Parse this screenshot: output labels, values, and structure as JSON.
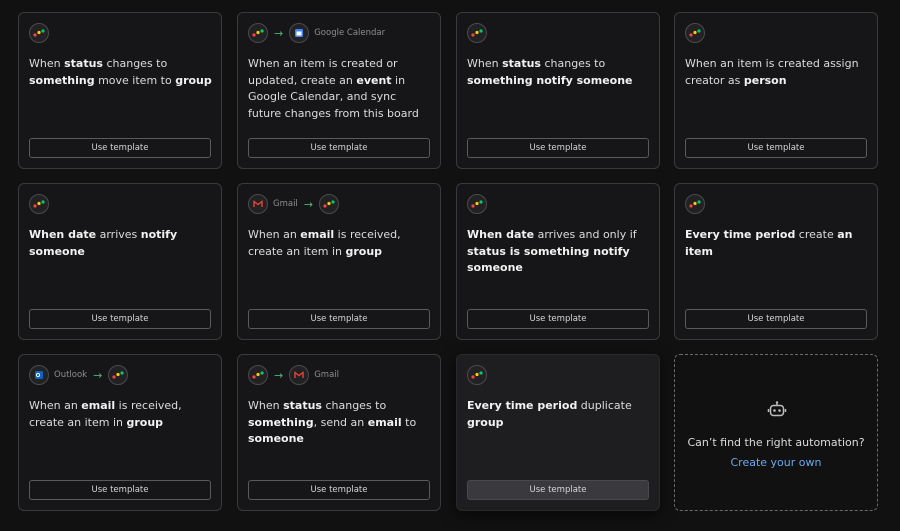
{
  "templates": [
    {
      "segments": [
        {
          "t": "When ",
          "b": false
        },
        {
          "t": "status",
          "b": true
        },
        {
          "t": " changes to ",
          "b": false
        },
        {
          "t": "something",
          "b": true
        },
        {
          "t": " move item to ",
          "b": false
        },
        {
          "t": "group",
          "b": true
        }
      ],
      "button": "Use template"
    },
    {
      "apps": {
        "from": "",
        "to": "Google Calendar"
      },
      "segments": [
        {
          "t": "When an item is created or updated, create an ",
          "b": false
        },
        {
          "t": "event",
          "b": true
        },
        {
          "t": " in Google Calendar, and sync future changes from this board",
          "b": false
        }
      ],
      "button": "Use template"
    },
    {
      "segments": [
        {
          "t": "When ",
          "b": false
        },
        {
          "t": "status",
          "b": true
        },
        {
          "t": " changes to ",
          "b": false
        },
        {
          "t": "something notify someone",
          "b": true
        }
      ],
      "button": "Use template"
    },
    {
      "segments": [
        {
          "t": "When an item is created assign creator as ",
          "b": false
        },
        {
          "t": "person",
          "b": true
        }
      ],
      "button": "Use template"
    },
    {
      "segments": [
        {
          "t": "When date",
          "b": true
        },
        {
          "t": " arrives ",
          "b": false
        },
        {
          "t": "notify someone",
          "b": true
        }
      ],
      "button": "Use template"
    },
    {
      "apps": {
        "from": "Gmail",
        "to": ""
      },
      "segments": [
        {
          "t": "When an ",
          "b": false
        },
        {
          "t": "email",
          "b": true
        },
        {
          "t": " is received, create an item in ",
          "b": false
        },
        {
          "t": "group",
          "b": true
        }
      ],
      "button": "Use template"
    },
    {
      "segments": [
        {
          "t": "When date",
          "b": true
        },
        {
          "t": " arrives and only if ",
          "b": false
        },
        {
          "t": "status is something notify someone",
          "b": true
        }
      ],
      "button": "Use template"
    },
    {
      "segments": [
        {
          "t": "Every time period",
          "b": true
        },
        {
          "t": " create ",
          "b": false
        },
        {
          "t": "an item",
          "b": true
        }
      ],
      "button": "Use template"
    },
    {
      "apps": {
        "from": "Outlook",
        "to": ""
      },
      "segments": [
        {
          "t": "When an ",
          "b": false
        },
        {
          "t": "email",
          "b": true
        },
        {
          "t": " is received, create an item in ",
          "b": false
        },
        {
          "t": "group",
          "b": true
        }
      ],
      "button": "Use template"
    },
    {
      "apps": {
        "from": "",
        "to": "Gmail"
      },
      "segments": [
        {
          "t": "When ",
          "b": false
        },
        {
          "t": "status",
          "b": true
        },
        {
          "t": " changes to ",
          "b": false
        },
        {
          "t": "something",
          "b": true
        },
        {
          "t": ", send an ",
          "b": false
        },
        {
          "t": "email",
          "b": true
        },
        {
          "t": " to ",
          "b": false
        },
        {
          "t": "someone",
          "b": true
        }
      ],
      "button": "Use template"
    },
    {
      "segments": [
        {
          "t": "Every time period",
          "b": true
        },
        {
          "t": " duplicate ",
          "b": false
        },
        {
          "t": "group",
          "b": true
        }
      ],
      "button": "Use template"
    }
  ],
  "create_own": {
    "prompt": "Can’t find the right automation?",
    "link": "Create your own"
  },
  "colors": {
    "accent_link": "#6aa8f0",
    "arrow": "#4fb37a",
    "monday_red": "#f2453d",
    "monday_yellow": "#ffcc00",
    "monday_green": "#00ca72"
  }
}
